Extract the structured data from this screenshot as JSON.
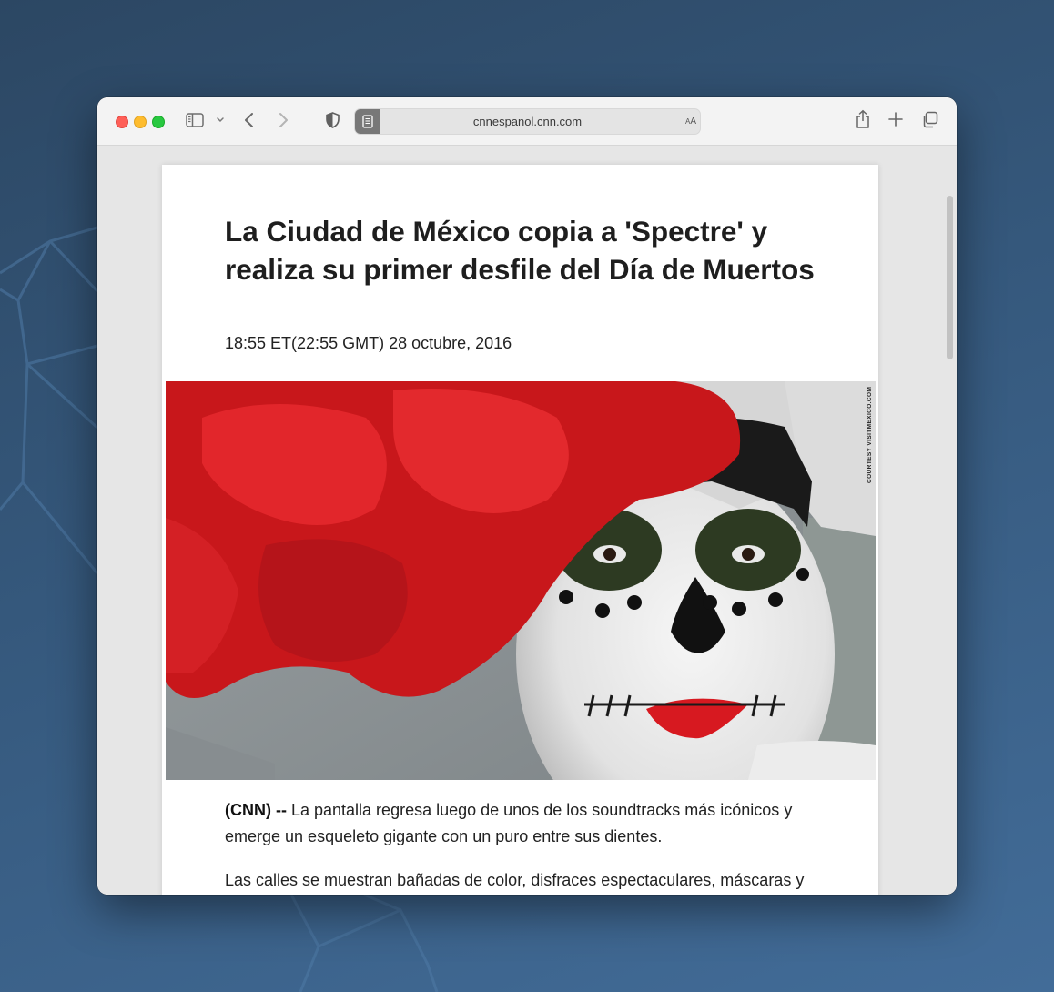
{
  "browser": {
    "url": "cnnespanol.cnn.com",
    "text_size_label": "AA"
  },
  "article": {
    "headline": "La Ciudad de México copia a 'Spectre' y realiza su primer desfile del Día de Muertos",
    "dateline": "18:55 ET(22:55 GMT) 28 octubre, 2016",
    "image_credit": "COURTESY VISITMEXICO.COM",
    "paragraphs": [
      {
        "lead": "(CNN) --",
        "text": " La pantalla regresa luego de unos de los soundtracks más icónicos y emerge un esqueleto gigante con un puro entre sus dientes."
      },
      {
        "lead": "",
        "text": "Las calles se muestran bañadas de color, disfraces espectaculares, máscaras y"
      }
    ]
  },
  "colors": {
    "close": "#fe5f57",
    "minimize": "#febc2e",
    "zoom": "#28c840"
  },
  "icons": [
    "sidebar-icon",
    "chevron-down-icon",
    "back-icon",
    "forward-icon",
    "shield-icon",
    "reader-icon",
    "share-icon",
    "plus-icon",
    "tabs-icon"
  ]
}
